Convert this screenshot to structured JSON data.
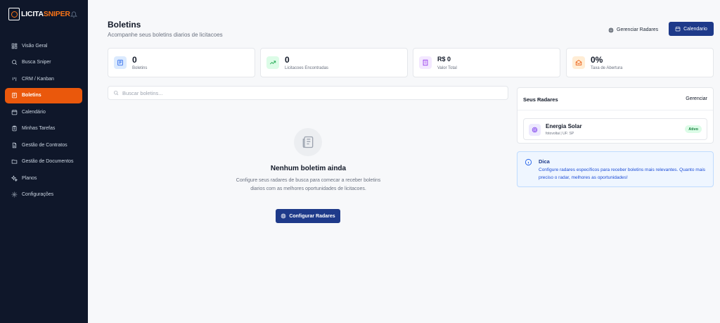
{
  "brand": {
    "part1": "LICITA",
    "part2": "SNIPER"
  },
  "nav": [
    {
      "label": "Visão Geral",
      "icon": "dashboard-icon",
      "active": false
    },
    {
      "label": "Busca Sniper",
      "icon": "search-icon",
      "active": false
    },
    {
      "label": "CRM / Kanban",
      "icon": "kanban-icon",
      "active": false
    },
    {
      "label": "Boletins",
      "icon": "newspaper-icon",
      "active": true
    },
    {
      "label": "Calendário",
      "icon": "calendar-icon",
      "active": false
    },
    {
      "label": "Minhas Tarefas",
      "icon": "clipboard-icon",
      "active": false
    },
    {
      "label": "Gestão de Contratos",
      "icon": "file-icon",
      "active": false
    },
    {
      "label": "Gestão de Documentos",
      "icon": "folder-icon",
      "active": false
    },
    {
      "label": "Planos",
      "icon": "sparkles-icon",
      "active": false
    },
    {
      "label": "Configurações",
      "icon": "gear-icon",
      "active": false
    }
  ],
  "header": {
    "title": "Boletins",
    "subtitle": "Acompanhe seus boletins diarios de licitacoes",
    "manage_radars_label": "Gerenciar Radares",
    "calendar_label": "Calendario"
  },
  "stats": [
    {
      "value": "0",
      "label": "Boletins",
      "icon": "newspaper-icon",
      "bg": "#dbeafe",
      "fg": "#2563eb"
    },
    {
      "value": "0",
      "label": "Licitacoes Encontradas",
      "icon": "trending-up-icon",
      "bg": "#dcfce7",
      "fg": "#16a34a"
    },
    {
      "value": "R$ 0",
      "label": "Valor Total",
      "icon": "building-icon",
      "bg": "#f3e8ff",
      "fg": "#9333ea"
    },
    {
      "value": "0%",
      "label": "Taxa de Abertura",
      "icon": "mail-open-icon",
      "bg": "#ffedd5",
      "fg": "#ea580c"
    }
  ],
  "search": {
    "placeholder": "Buscar boletins..."
  },
  "empty": {
    "title": "Nenhum boletim ainda",
    "description": "Configure seus radares de busca para comecar a receber boletins diarios com as melhores oportunidades de licitacoes.",
    "button_label": "Configurar Radares"
  },
  "radars": {
    "title": "Seus Radares",
    "manage_label": "Gerenciar",
    "items": [
      {
        "name": "Energia Solar",
        "meta": "fotovoltai | UF: SP",
        "status": "Ativo"
      }
    ]
  },
  "tip": {
    "title": "Dica",
    "text": "Configure radares específicos para receber boletins mais relevantes. Quanto mais preciso o radar, melhores as oportunidades!"
  },
  "colors": {
    "sidebar_bg": "#0f172a",
    "accent": "#ea580c",
    "primary": "#1e3a8a"
  }
}
